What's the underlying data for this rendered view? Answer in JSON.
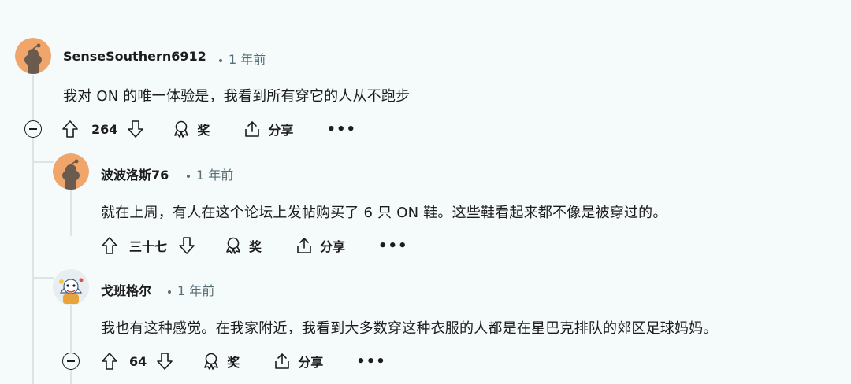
{
  "comments": [
    {
      "author": "SenseSouthern6912",
      "time": "1 年前",
      "text": "我对 ON 的唯一体验是，我看到所有穿它的人从不跑步",
      "votes": "264",
      "award_label": "奖",
      "share_label": "分享",
      "more_label": "•••",
      "avatar_color": "#f0a56b"
    },
    {
      "author": "波波洛斯76",
      "time": "1 年前",
      "text": "就在上周，有人在这个论坛上发帖购买了 6 只 ON 鞋。这些鞋看起来都不像是被穿过的。",
      "votes": "三十七",
      "award_label": "奖",
      "share_label": "分享",
      "more_label": "•••",
      "avatar_color": "#f0a56b"
    },
    {
      "author": "戈班格尔",
      "time": "1 年前",
      "text": "我也有这种感觉。在我家附近，我看到大多数穿这种衣服的人都是在星巴克排队的郊区足球妈妈。",
      "votes": "64",
      "award_label": "奖",
      "share_label": "分享",
      "more_label": "•••",
      "avatar_color": "#e8eef0"
    }
  ],
  "colors": {
    "background": "#f5fafb",
    "thread_line": "#dbe4e6",
    "meta_text": "#576f76",
    "primary_text": "#1c1c1c"
  }
}
